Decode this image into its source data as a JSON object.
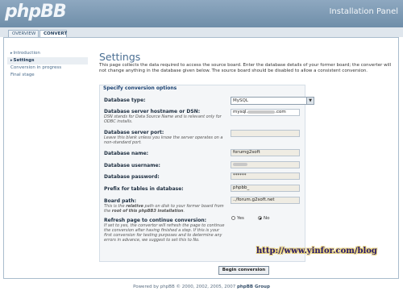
{
  "header": {
    "logo_text": "phpBB",
    "title": "Installation Panel"
  },
  "tabs": [
    {
      "label": "OVERVIEW",
      "active": false
    },
    {
      "label": "CONVERT",
      "active": true
    }
  ],
  "sidebar": {
    "items": [
      {
        "label": "Introduction",
        "state": "done"
      },
      {
        "label": "Settings",
        "state": "active"
      },
      {
        "label": "Conversion in progress",
        "state": "pending"
      },
      {
        "label": "Final stage",
        "state": "pending"
      }
    ]
  },
  "main": {
    "title": "Settings",
    "intro": "This page collects the data required to access the source board. Enter the database details of your former board; the converter will not change anything in the database given below. The source board should be disabled to allow a consistent conversion.",
    "legend": "Specify conversion options"
  },
  "form": {
    "db_type": {
      "label": "Database type:",
      "value": "MySQL"
    },
    "db_host": {
      "label": "Database server hostname or DSN:",
      "desc": "DSN stands for Data Source Name and is relevant only for ODBC installs.",
      "value_start": "mysql.",
      "value_end": ".com"
    },
    "db_port": {
      "label": "Database server port:",
      "desc": "Leave this blank unless you know the server operates on a non-standard port.",
      "value": ""
    },
    "db_name": {
      "label": "Database name:",
      "value": "forumg2soft"
    },
    "db_user": {
      "label": "Database username:",
      "value": ""
    },
    "db_pass": {
      "label": "Database password:",
      "value": "******"
    },
    "table_prefix": {
      "label": "Prefix for tables in database:",
      "value": "phpbb_"
    },
    "board_path": {
      "label": "Board path:",
      "desc_1": "This is the ",
      "desc_rel": "relative",
      "desc_2": " path on disk to your former board from the ",
      "desc_root": "root of this phpBB3 installation",
      "desc_3": ".",
      "value": "../forum.g2soft.net"
    },
    "refresh": {
      "label": "Refresh page to continue conversion:",
      "desc": "If set to yes, the convertor will refresh the page to continue the conversion after having finished a step. If this is your first conversion for testing purposes and to determine any errors in advance, we suggest to set this to No.",
      "yes_label": "Yes",
      "no_label": "No",
      "selected": "No"
    }
  },
  "watermark": "http://www.yinfor.com/blog",
  "submit_label": "Begin conversion",
  "footer": {
    "prefix": "Powered by phpBB © 2000, 2002, 2005, 2007 ",
    "group": "phpBB Group"
  }
}
